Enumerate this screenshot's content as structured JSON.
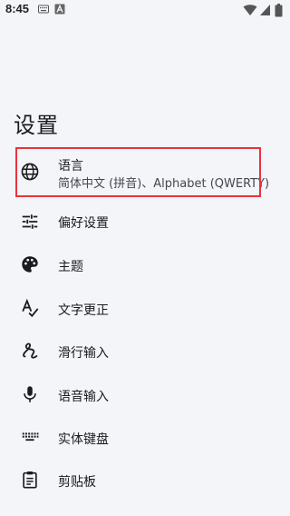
{
  "status_bar": {
    "time": "8:45",
    "icons": [
      "keyboard-icon",
      "text-icon",
      "wifi-icon",
      "signal-icon",
      "battery-icon"
    ]
  },
  "page": {
    "title": "设置"
  },
  "items": [
    {
      "icon": "globe-icon",
      "label": "语言",
      "sub": "简体中文 (拼音)、Alphabet (QWERTY)"
    },
    {
      "icon": "sliders-icon",
      "label": "偏好设置"
    },
    {
      "icon": "palette-icon",
      "label": "主题"
    },
    {
      "icon": "text-correction-icon",
      "label": "文字更正"
    },
    {
      "icon": "glide-typing-icon",
      "label": "滑行输入"
    },
    {
      "icon": "microphone-icon",
      "label": "语音输入"
    },
    {
      "icon": "keyboard-icon",
      "label": "实体键盘"
    },
    {
      "icon": "clipboard-icon",
      "label": "剪贴板"
    }
  ],
  "colors": {
    "background": "#f3f5f9",
    "highlight_border": "#e8333f",
    "text": "#1b1b1f"
  }
}
